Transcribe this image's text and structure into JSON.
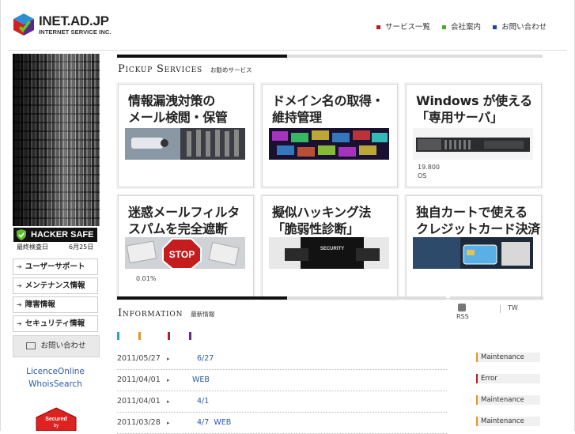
{
  "header": {
    "logo_title": "INET.AD.JP",
    "logo_sub": "INTERNET SERVICE INC.",
    "nav": [
      {
        "label": "サービス一覧",
        "color": "#c0161c"
      },
      {
        "label": "会社案内",
        "color": "#3fae2a"
      },
      {
        "label": "お問い合わせ",
        "color": "#1e3fb8"
      }
    ]
  },
  "sidebar": {
    "hacker_safe": "HACKER SAFE",
    "check_label": "最終検査日",
    "check_date": "6月25日",
    "items": [
      {
        "label": "ユーザーサポート"
      },
      {
        "label": "メンテナンス情報"
      },
      {
        "label": "障害情報"
      },
      {
        "label": "セキュリティ情報"
      }
    ],
    "contact_label": "お問い合わせ",
    "links": [
      "LicenceOnline",
      "WhoisSearch"
    ],
    "secured_label": "Secured by"
  },
  "pickup": {
    "title": "Pickup Services",
    "subtitle": "お勧めサービス",
    "cards": [
      {
        "line1": "情報漏洩対策の",
        "line2": "メール検閲・保管",
        "icon": "cctv-camera-image",
        "note1": "",
        "note2": ""
      },
      {
        "line1": "ドメイン名の取得・",
        "line2": "維持管理",
        "icon": "domain-keyboard-image",
        "note1": "",
        "note2": ""
      },
      {
        "line1": "Windows が使える",
        "line2": "「専用サーバ」",
        "icon": "rack-server-image",
        "note1": "19.800",
        "note2": "OS"
      },
      {
        "line1": "迷惑メールフィルタ",
        "line2": "スパムを完全遮断",
        "icon": "spam-stop-sign-image",
        "note1": "0.01%",
        "note2": ""
      },
      {
        "line1": "擬似ハッキング法",
        "line2": "「脆弱性診断」",
        "icon": "security-guard-image",
        "note1": "",
        "note2": ""
      },
      {
        "line1": "独自カートで使える",
        "line2": "クレジットカード決済",
        "icon": "credit-card-image",
        "note1": "",
        "note2": ""
      }
    ]
  },
  "information": {
    "title": "Information",
    "subtitle": "最新情報",
    "rss": "RSS",
    "tw": "TW",
    "filter_colors": [
      "#2aa6b8",
      "#e0962a",
      "#b0232a",
      "#6a2a92"
    ],
    "rows": [
      {
        "date": "2011/05/27",
        "title": "6/27",
        "tag": "Maintenance",
        "tag_color": "#e0962a"
      },
      {
        "date": "2011/04/01",
        "title": "WEB",
        "tag": "Error",
        "tag_color": "#b0232a"
      },
      {
        "date": "2011/04/01",
        "title": "4/1",
        "tag": "Maintenance",
        "tag_color": "#e0962a"
      },
      {
        "date": "2011/03/28",
        "title": "4/7  WEB",
        "tag": "Maintenance",
        "tag_color": "#e0962a"
      }
    ]
  }
}
